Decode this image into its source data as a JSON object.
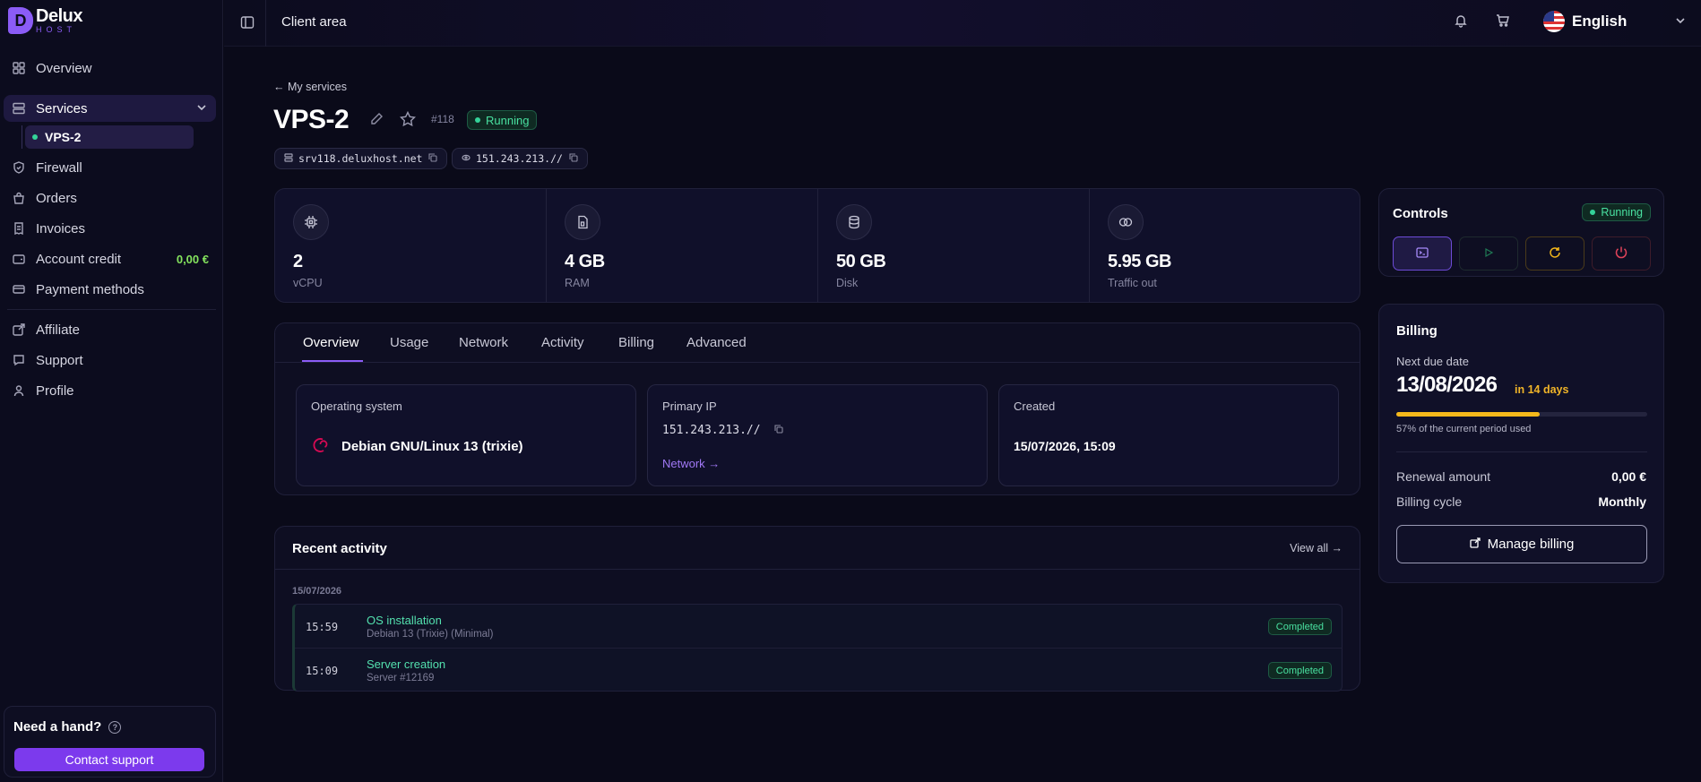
{
  "brand": {
    "name": "Delux",
    "tagline": "HOST",
    "mark": "D",
    "accent": "#8b5cf6"
  },
  "sidebar": {
    "items": [
      {
        "label": "Overview",
        "icon": "grid-icon"
      },
      {
        "label": "Services",
        "icon": "server-icon"
      },
      {
        "label": "Firewall",
        "icon": "shield-icon"
      },
      {
        "label": "Orders",
        "icon": "bag-icon"
      },
      {
        "label": "Invoices",
        "icon": "receipt-icon"
      },
      {
        "label": "Account credit",
        "icon": "wallet-icon",
        "value": "0,00 €"
      },
      {
        "label": "Payment methods",
        "icon": "card-icon"
      },
      {
        "label": "Affiliate",
        "icon": "share-icon"
      },
      {
        "label": "Support",
        "icon": "chat-icon"
      },
      {
        "label": "Profile",
        "icon": "user-icon"
      }
    ],
    "sub_item": "VPS-2",
    "help": {
      "title": "Need a hand?",
      "button": "Contact support"
    }
  },
  "topbar": {
    "title": "Client area",
    "language": "English"
  },
  "service": {
    "back": "← My services",
    "name": "VPS-2",
    "id": "#118",
    "status": "Running",
    "hostname": "srv118.deluxhost.net",
    "ip": "151.243.213.//"
  },
  "specs": [
    {
      "value": "2",
      "label": "vCPU",
      "icon": "cpu-icon"
    },
    {
      "value": "4 GB",
      "label": "RAM",
      "icon": "memory-icon"
    },
    {
      "value": "50 GB",
      "label": "Disk",
      "icon": "database-icon"
    },
    {
      "value": "5.95 GB",
      "label": "Traffic out",
      "icon": "traffic-icon"
    }
  ],
  "tabs": [
    "Overview",
    "Usage",
    "Network",
    "Activity",
    "Billing",
    "Advanced"
  ],
  "overview": {
    "os_label": "Operating system",
    "os_value": "Debian GNU/Linux 13 (trixie)",
    "ip_label": "Primary IP",
    "ip_value": "151.243.213.//",
    "ip_link": "Network →",
    "created_label": "Created",
    "created_value": "15/07/2026, 15:09"
  },
  "activity": {
    "title": "Recent activity",
    "view_all": "View all →",
    "date": "15/07/2026",
    "rows": [
      {
        "time": "15:59",
        "name": "OS installation",
        "detail": "Debian 13 (Trixie) (Minimal)",
        "status": "Completed"
      },
      {
        "time": "15:09",
        "name": "Server creation",
        "detail": "Server #12169",
        "status": "Completed"
      }
    ]
  },
  "controls": {
    "title": "Controls",
    "status": "Running",
    "buttons": [
      {
        "name": "console",
        "color": "#8b5cf6"
      },
      {
        "name": "start",
        "color": "#1f7a55"
      },
      {
        "name": "restart",
        "color": "#f5b81b"
      },
      {
        "name": "stop",
        "color": "#e0435a"
      }
    ]
  },
  "billing": {
    "title": "Billing",
    "next_due_label": "Next due date",
    "next_due": "13/08/2026",
    "in_days": "in 14 days",
    "period_used": 57,
    "period_text": "57% of the current period used",
    "renewal_label": "Renewal amount",
    "renewal_value": "0,00 €",
    "cycle_label": "Billing cycle",
    "cycle_value": "Monthly",
    "button": "Manage billing"
  }
}
